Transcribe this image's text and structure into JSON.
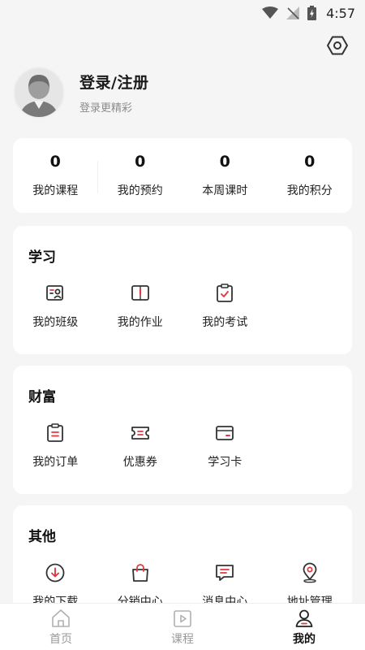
{
  "status_bar": {
    "time": "4:57"
  },
  "profile": {
    "title": "登录/注册",
    "subtitle": "登录更精彩"
  },
  "stats": [
    {
      "value": "0",
      "label": "我的课程"
    },
    {
      "value": "0",
      "label": "我的预约"
    },
    {
      "value": "0",
      "label": "本周课时"
    },
    {
      "value": "0",
      "label": "我的积分"
    }
  ],
  "learn": {
    "title": "学习",
    "items": [
      {
        "label": "我的班级",
        "icon": "class-icon"
      },
      {
        "label": "我的作业",
        "icon": "homework-icon"
      },
      {
        "label": "我的考试",
        "icon": "exam-icon"
      }
    ]
  },
  "wealth": {
    "title": "财富",
    "items": [
      {
        "label": "我的订单",
        "icon": "order-icon"
      },
      {
        "label": "优惠券",
        "icon": "coupon-icon"
      },
      {
        "label": "学习卡",
        "icon": "study-card-icon"
      }
    ]
  },
  "other": {
    "title": "其他",
    "items": [
      {
        "label": "我的下载",
        "icon": "download-icon"
      },
      {
        "label": "分销中心",
        "icon": "distribution-icon"
      },
      {
        "label": "消息中心",
        "icon": "message-icon"
      },
      {
        "label": "地址管理",
        "icon": "location-icon"
      }
    ]
  },
  "tabs": [
    {
      "label": "首页",
      "icon": "home-icon"
    },
    {
      "label": "课程",
      "icon": "course-icon"
    },
    {
      "label": "我的",
      "icon": "profile-icon",
      "active": true
    }
  ],
  "colors": {
    "accent": "#e0393e",
    "icon_stroke": "#333333",
    "tab_inactive": "#9a9a9a"
  }
}
